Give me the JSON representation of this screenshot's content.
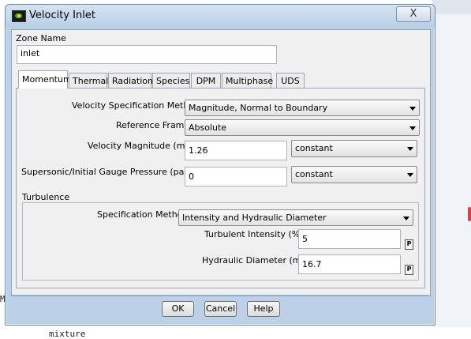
{
  "window": {
    "title": "Velocity Inlet",
    "close_label": "X"
  },
  "zone": {
    "label": "Zone Name",
    "value": "inlet"
  },
  "tabs": [
    {
      "label": "Momentum",
      "active": true
    },
    {
      "label": "Thermal"
    },
    {
      "label": "Radiation"
    },
    {
      "label": "Species"
    },
    {
      "label": "DPM"
    },
    {
      "label": "Multiphase"
    },
    {
      "label": "UDS"
    }
  ],
  "momentum": {
    "velocity_spec": {
      "label": "Velocity Specification Method",
      "value": "Magnitude, Normal to Boundary"
    },
    "reference_frame": {
      "label": "Reference Frame",
      "value": "Absolute"
    },
    "velocity_magnitude": {
      "label": "Velocity Magnitude (m/s)",
      "value": "1.26",
      "profile": "constant"
    },
    "gauge_pressure": {
      "label": "Supersonic/Initial Gauge Pressure (pascal)",
      "value": "0",
      "profile": "constant"
    }
  },
  "turbulence": {
    "title": "Turbulence",
    "spec_method": {
      "label": "Specification Method",
      "value": "Intensity and Hydraulic Diameter"
    },
    "intensity": {
      "label": "Turbulent Intensity (%)",
      "value": "5",
      "param_label": "P"
    },
    "hydraulic_diameter": {
      "label": "Hydraulic Diameter (mm)",
      "value": "16.7",
      "param_label": "P"
    }
  },
  "buttons": {
    "ok": "OK",
    "cancel": "Cancel",
    "help": "Help"
  },
  "background": {
    "bottom_text": "mixture",
    "left_char": "M"
  }
}
